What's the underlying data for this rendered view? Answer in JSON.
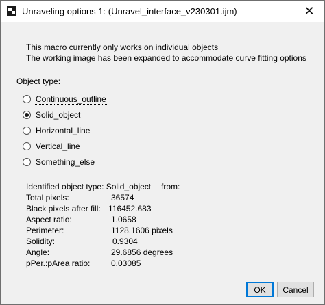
{
  "window": {
    "title": "Unraveling options 1: (Unravel_interface_v230301.ijm)",
    "close_glyph": "✕"
  },
  "messages": [
    "This macro currently only works on individual objects",
    "The working image has been expanded to accommodate curve fitting options"
  ],
  "object_type": {
    "label": "Object type:",
    "selected": "Solid_object",
    "options": [
      "Continuous_outline",
      "Solid_object",
      "Horizontal_line",
      "Vertical_line",
      "Something_else"
    ]
  },
  "stats": {
    "identified_label": "Identified object type: Solid_object",
    "identified_suffix": "from:",
    "rows": [
      {
        "label": "Total pixels:",
        "value": "36574"
      },
      {
        "label": "Black pixels after fill:",
        "value": "116452.683"
      },
      {
        "label": "Aspect ratio:",
        "value": "1.0658"
      },
      {
        "label": "Perimeter:",
        "value": "1128.1606 pixels"
      },
      {
        "label": "Solidity:",
        "value": "0.9304"
      },
      {
        "label": "Angle:",
        "value": "29.6856 degrees"
      },
      {
        "label": "pPer.:pArea ratio:",
        "value": "0.03085"
      }
    ]
  },
  "buttons": {
    "ok": "OK",
    "cancel": "Cancel"
  }
}
